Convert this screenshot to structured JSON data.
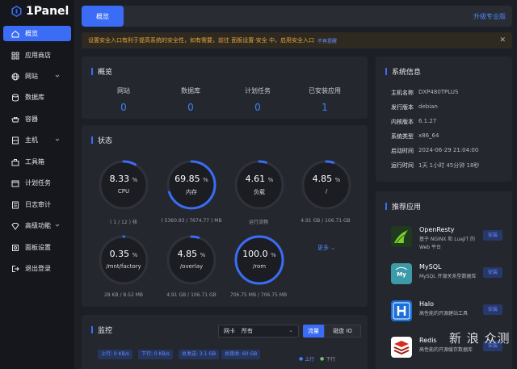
{
  "app": {
    "logo_text": "1Panel"
  },
  "sidebar": {
    "items": [
      {
        "label": "概览",
        "icon": "home-icon",
        "active": true
      },
      {
        "label": "应用商店",
        "icon": "grid-icon"
      },
      {
        "label": "网站",
        "icon": "globe-icon",
        "has_children": true
      },
      {
        "label": "数据库",
        "icon": "database-icon"
      },
      {
        "label": "容器",
        "icon": "container-icon"
      },
      {
        "label": "主机",
        "icon": "host-icon",
        "has_children": true
      },
      {
        "label": "工具箱",
        "icon": "toolbox-icon"
      },
      {
        "label": "计划任务",
        "icon": "calendar-icon"
      },
      {
        "label": "日志审计",
        "icon": "log-icon"
      },
      {
        "label": "高级功能",
        "icon": "diamond-icon",
        "has_children": true
      },
      {
        "label": "面板设置",
        "icon": "settings-icon"
      },
      {
        "label": "退出登录",
        "icon": "logout-icon"
      }
    ]
  },
  "topbar": {
    "tab": "概览",
    "upgrade": "升级专业版"
  },
  "alert": {
    "text": "设置安全入口有利于提高系统的安全性，如有需要，前往 面板设置-安全 中，启用安全入口",
    "link": "不再提醒"
  },
  "overview": {
    "title": "概览",
    "items": [
      {
        "label": "网站",
        "value": "0"
      },
      {
        "label": "数据库",
        "value": "0"
      },
      {
        "label": "计划任务",
        "value": "0"
      },
      {
        "label": "已安装应用",
        "value": "1"
      }
    ]
  },
  "status": {
    "title": "状态",
    "more": "更多",
    "gauges": [
      {
        "value": "8.33",
        "unit": "%",
        "label": "CPU",
        "sub": "( 1 / 12 ) 核",
        "percent": 8.33
      },
      {
        "value": "69.85",
        "unit": "%",
        "label": "内存",
        "sub": "( 5360.93 / 7674.77 ) MB",
        "percent": 69.85
      },
      {
        "value": "4.61",
        "unit": "%",
        "label": "负载",
        "sub": "运行流畅",
        "percent": 4.61
      },
      {
        "value": "4.85",
        "unit": "%",
        "label": "/",
        "sub": "4.91 GB / 106.71 GB",
        "percent": 4.85
      },
      {
        "value": "0.35",
        "unit": "%",
        "label": "/mnt/factory",
        "sub": "28 KB / 8.52 MB",
        "percent": 0.35
      },
      {
        "value": "4.85",
        "unit": "%",
        "label": "/overlay",
        "sub": "4.91 GB / 106.71 GB",
        "percent": 4.85
      },
      {
        "value": "100.0",
        "unit": "%",
        "label": "/rom",
        "sub": "706.75 MB / 706.75 MB",
        "percent": 100
      }
    ]
  },
  "monitor": {
    "title": "监控",
    "select_label": "网卡",
    "select_value": "所有",
    "btn_flow": "流量",
    "btn_disk": "磁盘 IO",
    "tags": [
      "上行: 0 KB/s",
      "下行: 0 KB/s",
      "总发送: 3.1 GB",
      "总接收: 60 GB"
    ],
    "legend_up": "上行",
    "legend_down": "下行"
  },
  "sysinfo": {
    "title": "系统信息",
    "rows": [
      {
        "key": "主机名称",
        "value": "DXP480TPLUS"
      },
      {
        "key": "发行版本",
        "value": "debian"
      },
      {
        "key": "内核版本",
        "value": "6.1.27"
      },
      {
        "key": "系统类型",
        "value": "x86_64"
      },
      {
        "key": "启动时间",
        "value": "2024-06-29 21:04:00"
      },
      {
        "key": "运行时间",
        "value": "1天 1小时 45分钟 18秒"
      }
    ]
  },
  "apps": {
    "title": "推荐应用",
    "install": "安装",
    "items": [
      {
        "name": "OpenResty",
        "desc": "基于 NGINX 和 LuaJIT 的 Web 平台",
        "icon": "openresty-icon"
      },
      {
        "name": "MySQL",
        "desc": "MySQL 开源关系型数据库",
        "icon": "mysql-icon"
      },
      {
        "name": "Halo",
        "desc": "高性能的开源建站工具",
        "icon": "halo-icon"
      },
      {
        "name": "Redis",
        "desc": "高性能的开源缓存数据库",
        "icon": "redis-icon"
      }
    ]
  },
  "watermark": "新 浪 众测",
  "colors": {
    "accent": "#3b6cf6",
    "value_blue": "#3b82f6",
    "warning": "#e6a23c"
  }
}
